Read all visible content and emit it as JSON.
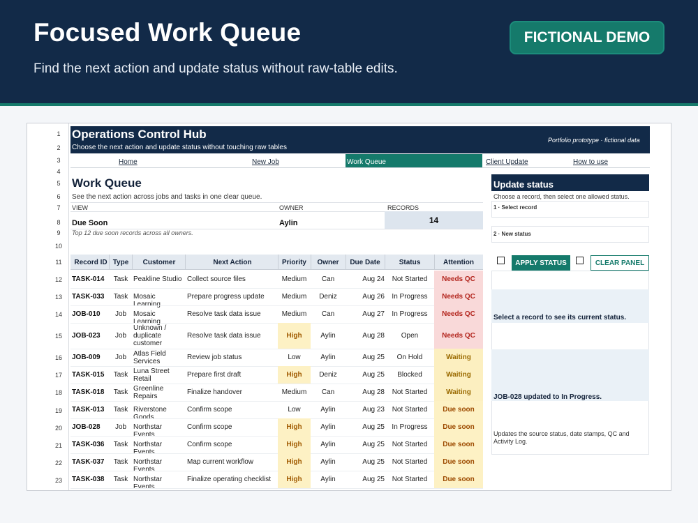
{
  "banner": {
    "title": "Focused Work Queue",
    "subtitle": "Find the next action and update status without raw-table edits.",
    "badge": "FICTIONAL DEMO"
  },
  "sheet": {
    "row_numbers": [
      "1",
      "2",
      "3",
      "4",
      "5",
      "6",
      "7",
      "8",
      "9",
      "10",
      "11",
      "12",
      "13",
      "14",
      "15",
      "16",
      "17",
      "18",
      "19",
      "20",
      "21",
      "22",
      "23"
    ],
    "hub": {
      "title": "Operations Control Hub",
      "subtitle": "Choose the next action and update status without touching raw tables",
      "tag": "Portfolio prototype · fictional data"
    },
    "nav": {
      "home": "Home",
      "new_job": "New Job",
      "work_queue": "Work Queue",
      "client_update": "Client Update",
      "how_to_use": "How to use"
    },
    "work_queue": {
      "title": "Work Queue",
      "subtitle": "See the next action across jobs and tasks in one clear queue.",
      "view_label": "VIEW",
      "view_value": "Due Soon",
      "owner_label": "OWNER",
      "owner_value": "Aylin",
      "records_label": "RECORDS",
      "records_value": "14",
      "note": "Top 12 due soon records across all owners."
    },
    "table": {
      "headers": [
        "Record ID",
        "Type",
        "Customer",
        "Next Action",
        "Priority",
        "Owner",
        "Due Date",
        "Status",
        "Attention"
      ],
      "rows": [
        [
          "TASK-014",
          "Task",
          "Peakline Studio",
          "Collect source files",
          "Medium",
          "Can",
          "Aug 24",
          "Not Started",
          "Needs QC"
        ],
        [
          "TASK-033",
          "Task",
          "Mosaic Learning",
          "Prepare progress update",
          "Medium",
          "Deniz",
          "Aug 26",
          "In Progress",
          "Needs QC"
        ],
        [
          "JOB-010",
          "Job",
          "Mosaic Learning",
          "Resolve task data issue",
          "Medium",
          "Can",
          "Aug 27",
          "In Progress",
          "Needs QC"
        ],
        [
          "JOB-023",
          "Job",
          "Unknown / duplicate customer",
          "Resolve task data issue",
          "High",
          "Aylin",
          "Aug 28",
          "Open",
          "Needs QC"
        ],
        [
          "JOB-009",
          "Job",
          "Atlas Field Services",
          "Review job status",
          "Low",
          "Aylin",
          "Aug 25",
          "On Hold",
          "Waiting"
        ],
        [
          "TASK-015",
          "Task",
          "Luna Street Retail",
          "Prepare first draft",
          "High",
          "Deniz",
          "Aug 25",
          "Blocked",
          "Waiting"
        ],
        [
          "TASK-018",
          "Task",
          "Greenline Repairs",
          "Finalize handover",
          "Medium",
          "Can",
          "Aug 28",
          "Not Started",
          "Waiting"
        ],
        [
          "TASK-013",
          "Task",
          "Riverstone Goods",
          "Confirm scope",
          "Low",
          "Aylin",
          "Aug 23",
          "Not Started",
          "Due soon"
        ],
        [
          "JOB-028",
          "Job",
          "Northstar Events",
          "Confirm scope",
          "High",
          "Aylin",
          "Aug 25",
          "In Progress",
          "Due soon"
        ],
        [
          "TASK-036",
          "Task",
          "Northstar Events",
          "Confirm scope",
          "High",
          "Aylin",
          "Aug 25",
          "Not Started",
          "Due soon"
        ],
        [
          "TASK-037",
          "Task",
          "Northstar Events",
          "Map current workflow",
          "High",
          "Aylin",
          "Aug 25",
          "Not Started",
          "Due soon"
        ],
        [
          "TASK-038",
          "Task",
          "Northstar Events",
          "Finalize operating checklist",
          "High",
          "Aylin",
          "Aug 25",
          "Not Started",
          "Due soon"
        ]
      ]
    },
    "panel": {
      "title": "Update status",
      "instruction": "Choose a record, then select one allowed status.",
      "step1": "1 · Select record",
      "step2": "2 · New status",
      "apply": "APPLY STATUS",
      "clear": "CLEAR PANEL",
      "select_prompt": "Select a record to see its current status.",
      "result": "JOB-028 updated to In Progress.",
      "footnote": "Updates the source status, date stamps, QC and Activity Log."
    }
  },
  "colors": {
    "navy": "#122a48",
    "teal": "#157a6b",
    "needs_qc_bg": "#f9d9d9",
    "needs_qc_text": "#b3261e",
    "waiting_bg": "#fcefc0",
    "waiting_text": "#9a6a00",
    "due_soon_bg": "#fdf1c4",
    "due_soon_text": "#9c4a00",
    "high_bg": "#fdf1c4",
    "high_text": "#a05a00"
  }
}
